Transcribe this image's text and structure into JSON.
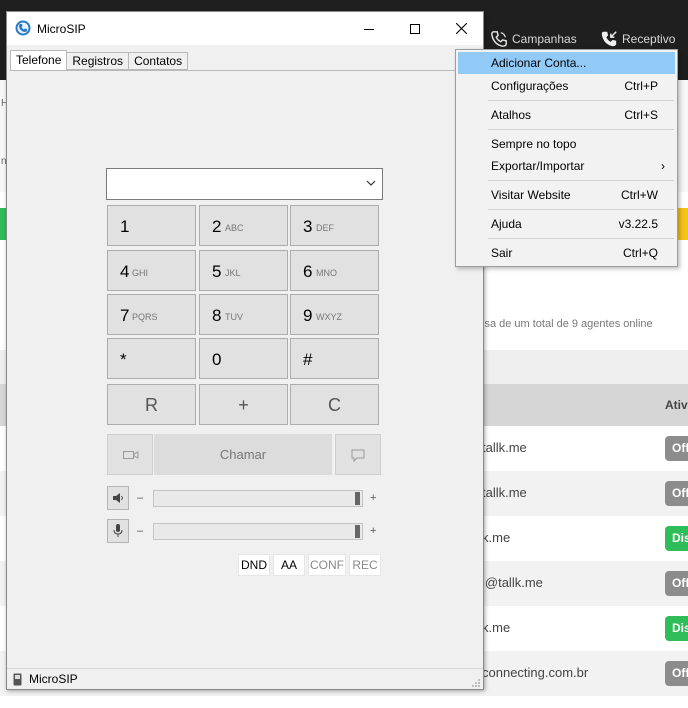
{
  "background": {
    "nav": [
      {
        "label": "Campanhas",
        "icon": "phone-icon"
      },
      {
        "label": "Receptivo",
        "icon": "incoming-call-icon"
      }
    ],
    "agents_text": "isa de um total de 9 agentes online",
    "table_header": "Ativ",
    "left_letters": [
      "H",
      "n"
    ],
    "rows": [
      {
        "email": "tallk.me",
        "status": "Off",
        "status_color": "#8c8c8c"
      },
      {
        "email": "tallk.me",
        "status": "Off",
        "status_color": "#8c8c8c"
      },
      {
        "email": "k.me",
        "status": "Dis",
        "status_color": "#2ebd59"
      },
      {
        "email": "i@tallk.me",
        "status": "Off",
        "status_color": "#8c8c8c"
      },
      {
        "email": "k.me",
        "status": "Dis",
        "status_color": "#2ebd59"
      },
      {
        "email": "connecting.com.br",
        "status": "Off",
        "status_color": "#8c8c8c"
      }
    ]
  },
  "window": {
    "title": "MicroSIP",
    "tabs": [
      "Telefone",
      "Registros",
      "Contatos"
    ],
    "dial_input": "",
    "keypad": [
      {
        "num": "1",
        "sub": ""
      },
      {
        "num": "2",
        "sub": "ABC"
      },
      {
        "num": "3",
        "sub": "DEF"
      },
      {
        "num": "4",
        "sub": "GHI"
      },
      {
        "num": "5",
        "sub": "JKL"
      },
      {
        "num": "6",
        "sub": "MNO"
      },
      {
        "num": "7",
        "sub": "PQRS"
      },
      {
        "num": "8",
        "sub": "TUV"
      },
      {
        "num": "9",
        "sub": "WXYZ"
      },
      {
        "num": "*",
        "sub": ""
      },
      {
        "num": "0",
        "sub": ""
      },
      {
        "num": "#",
        "sub": ""
      }
    ],
    "actions": [
      "R",
      "+",
      "C"
    ],
    "call_label": "Chamar",
    "speaker_level": 1.0,
    "mic_level": 1.0,
    "minus": "–",
    "plus": "+",
    "toggles": [
      "DND",
      "AA",
      "CONF",
      "REC"
    ],
    "status": "MicroSIP"
  },
  "menu": {
    "items": [
      {
        "label": "Adicionar Conta...",
        "shortcut": ""
      },
      {
        "label": "Configurações",
        "shortcut": "Ctrl+P"
      },
      {
        "label": "Atalhos",
        "shortcut": "Ctrl+S"
      },
      {
        "label": "Sempre no topo",
        "shortcut": ""
      },
      {
        "label": "Exportar/Importar",
        "shortcut": "",
        "submenu_arrow": "›"
      },
      {
        "label": "Visitar Website",
        "shortcut": "Ctrl+W"
      },
      {
        "label": "Ajuda",
        "shortcut": "v3.22.5"
      },
      {
        "label": "Sair",
        "shortcut": "Ctrl+Q"
      }
    ]
  }
}
